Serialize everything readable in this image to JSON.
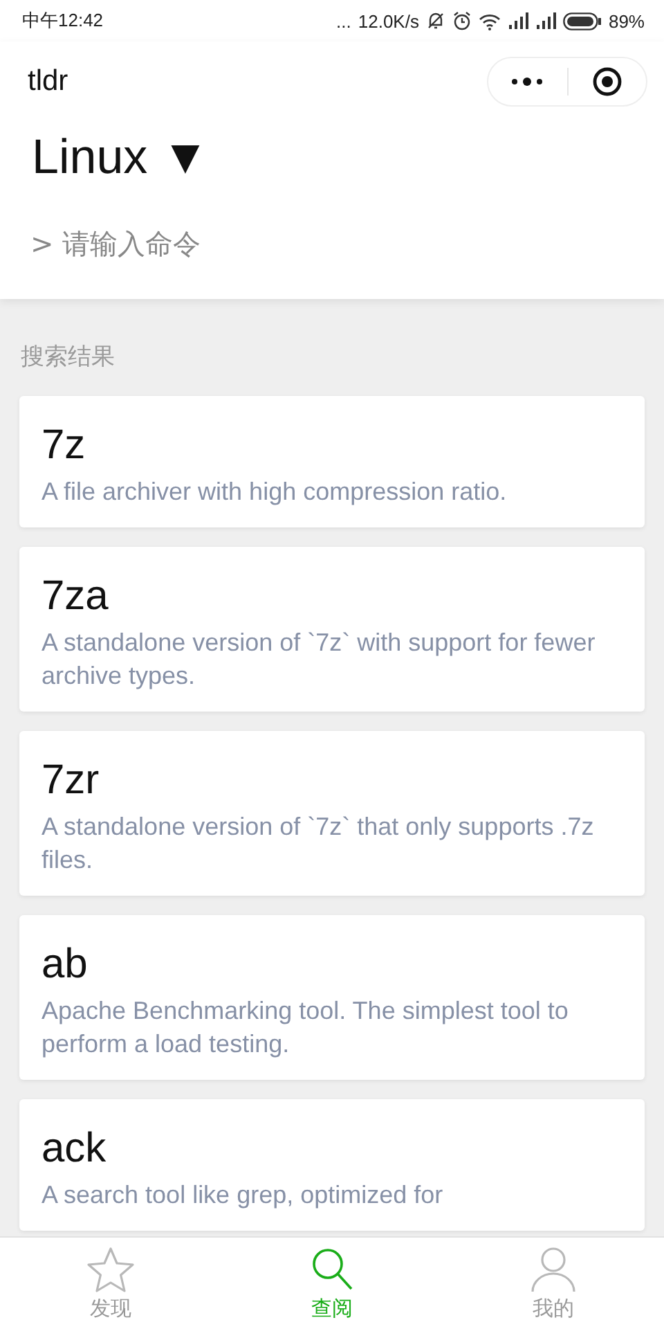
{
  "status_bar": {
    "time": "中午12:42",
    "more": "...",
    "speed": "12.0K/s",
    "battery_percent": "89%"
  },
  "nav": {
    "title": "tldr"
  },
  "platform": {
    "label": "Linux",
    "arrow": "▼"
  },
  "search": {
    "placeholder": "> 请输入命令"
  },
  "results": {
    "heading": "搜索结果",
    "items": [
      {
        "name": "7z",
        "description": "A file archiver with high compression ratio."
      },
      {
        "name": "7za",
        "description": "A standalone version of `7z` with support for fewer archive types."
      },
      {
        "name": "7zr",
        "description": "A standalone version of `7z` that only supports .7z files."
      },
      {
        "name": "ab",
        "description": "Apache Benchmarking tool. The simplest tool to perform a load testing."
      },
      {
        "name": "ack",
        "description": "A search tool like grep, optimized for"
      }
    ]
  },
  "tab_bar": [
    {
      "kind": "star",
      "label": "发现",
      "selected": false
    },
    {
      "kind": "search",
      "label": "查阅",
      "selected": true
    },
    {
      "kind": "person",
      "label": "我的",
      "selected": false
    }
  ]
}
